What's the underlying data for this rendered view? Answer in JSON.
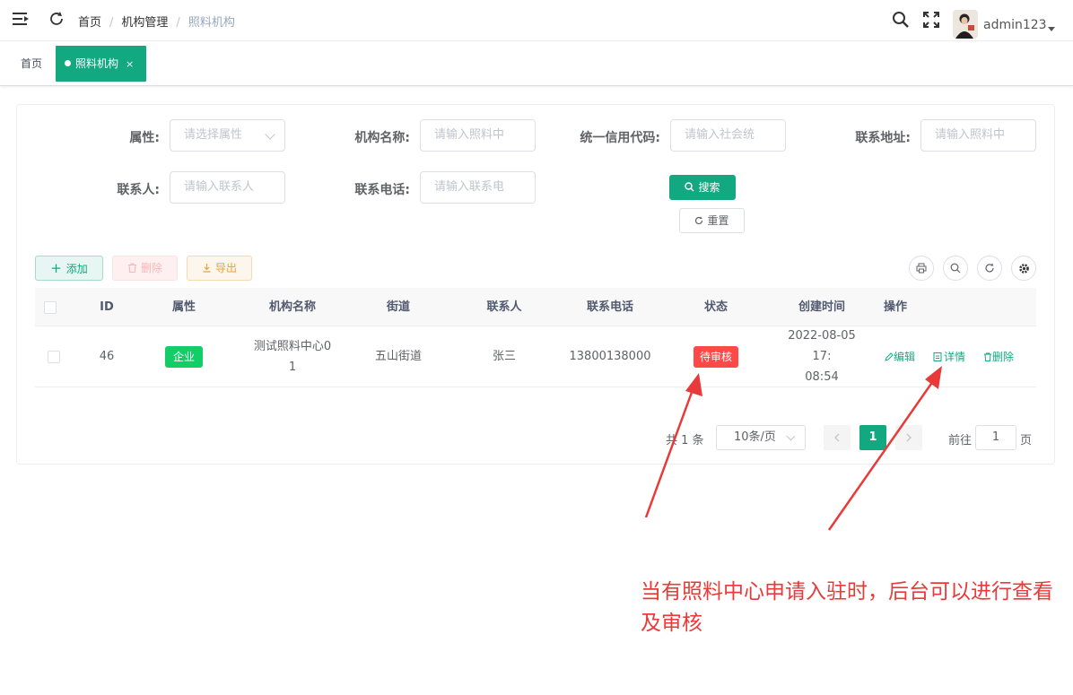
{
  "header": {
    "breadcrumb": [
      "首页",
      "机构管理",
      "照料机构"
    ],
    "username": "admin123",
    "sep": "/"
  },
  "tags": {
    "home": "首页",
    "active": "照料机构",
    "close": "×"
  },
  "filters": {
    "attr_label": "属性:",
    "attr_placeholder": "请选择属性",
    "name_label": "机构名称:",
    "name_placeholder": "请输入照料中",
    "credit_label": "统一信用代码:",
    "credit_placeholder": "请输入社会统",
    "address_label": "联系地址:",
    "address_placeholder": "请输入照料中",
    "contact_label": "联系人:",
    "contact_placeholder": "请输入联系人",
    "phone_label": "联系电话:",
    "phone_placeholder": "请输入联系电",
    "search_button": "搜索",
    "reset_button": "重置"
  },
  "toolbar": {
    "add": "添加",
    "delete": "删除",
    "export": "导出"
  },
  "table": {
    "columns": [
      "ID",
      "属性",
      "机构名称",
      "街道",
      "联系人",
      "联系电话",
      "状态",
      "创建时间",
      "操作"
    ],
    "rows": [
      {
        "id": "46",
        "attr": "企业",
        "name_line1": "测试照料中心0",
        "name_line2": "1",
        "street": "五山街道",
        "contact": "张三",
        "phone": "13800138000",
        "status": "待审核",
        "created_line1": "2022-08-05 17:",
        "created_line2": "08:54",
        "op_edit": "编辑",
        "op_detail": "详情",
        "op_delete": "删除"
      }
    ]
  },
  "pagination": {
    "total": "共 1 条",
    "page_size": "10条/页",
    "current": "1",
    "goto_label": "前往",
    "goto_value": "1",
    "page_unit": "页"
  },
  "annotation": "当有照料中心申请入驻时，后台可以进行查看及审核",
  "colors": {
    "primary": "#13a980",
    "danger": "#ff4949",
    "success": "#13ce66",
    "annotation": "#e93a3a"
  }
}
